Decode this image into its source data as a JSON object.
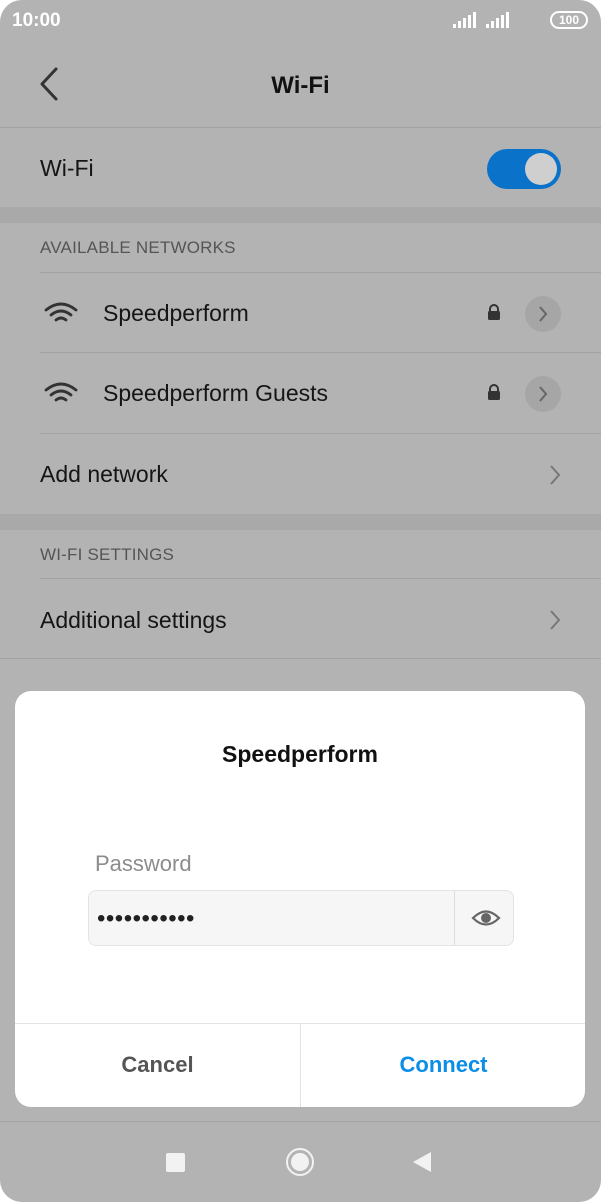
{
  "status_bar": {
    "time": "10:00",
    "battery": "100"
  },
  "header": {
    "title": "Wi-Fi",
    "back_icon": "chevron-left-icon"
  },
  "wifi": {
    "label": "Wi-Fi",
    "enabled": true,
    "toggle_color": "#0b72c9"
  },
  "available_networks": {
    "heading": "AVAILABLE NETWORKS",
    "items": [
      {
        "name": "Speedperform",
        "secured": true
      },
      {
        "name": "Speedperform Guests",
        "secured": true
      }
    ],
    "add_network": "Add network"
  },
  "wifi_settings": {
    "heading": "WI-FI SETTINGS",
    "additional": "Additional settings"
  },
  "dialog": {
    "title": "Speedperform",
    "password_label": "Password",
    "password_value": "•••••••••••",
    "cancel": "Cancel",
    "connect": "Connect",
    "connect_color": "#0a8ee8"
  },
  "nav": {
    "recents_icon": "square-icon",
    "home_icon": "circle-icon",
    "back_icon": "triangle-back-icon"
  }
}
